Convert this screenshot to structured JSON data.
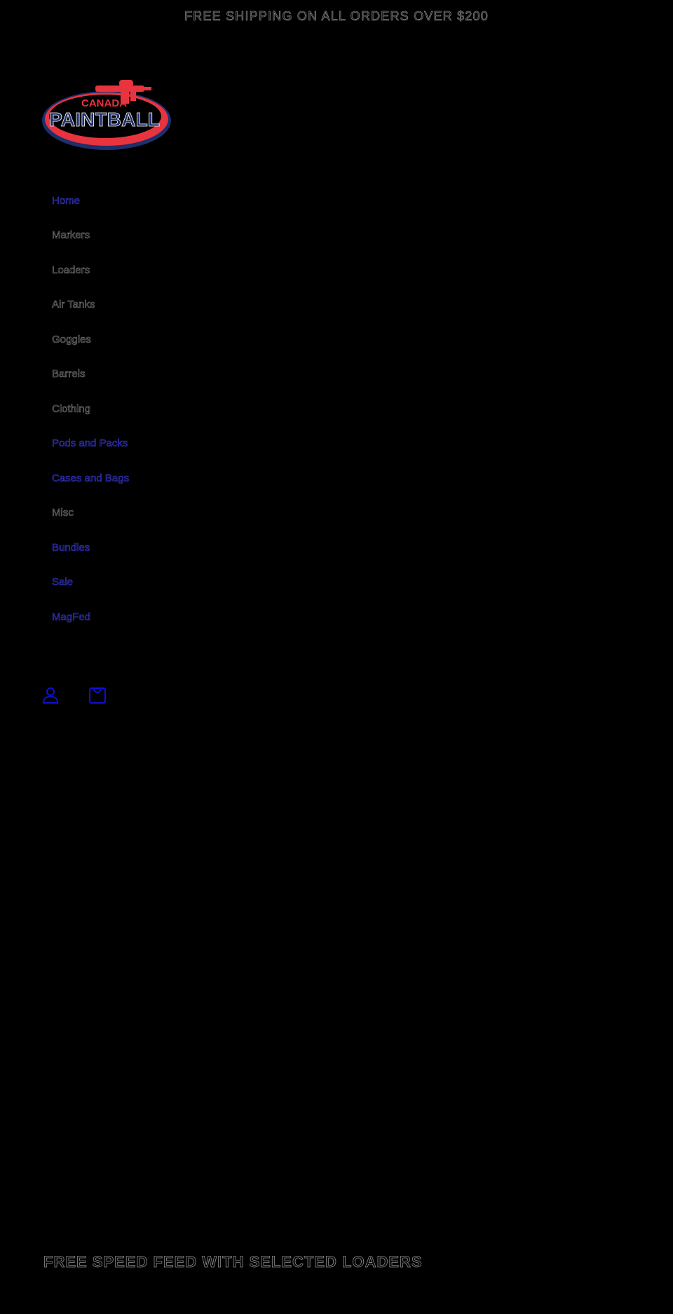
{
  "announcement": "FREE SHIPPING ON ALL ORDERS OVER $200",
  "logo": {
    "line1": "CANADA",
    "line2": "PAINTBALL"
  },
  "nav": [
    {
      "label": "Home",
      "active": true
    },
    {
      "label": "Markers",
      "active": false
    },
    {
      "label": "Loaders",
      "active": false
    },
    {
      "label": "Air Tanks",
      "active": false
    },
    {
      "label": "Goggles",
      "active": false
    },
    {
      "label": "Barrels",
      "active": false
    },
    {
      "label": "Clothing",
      "active": false
    },
    {
      "label": "Pods and Packs",
      "active": true
    },
    {
      "label": "Cases and Bags",
      "active": true
    },
    {
      "label": "Misc",
      "active": false
    },
    {
      "label": "Bundles",
      "active": true
    },
    {
      "label": "Sale",
      "active": true
    },
    {
      "label": "MagFed",
      "active": true
    }
  ],
  "header_icons": [
    "account-icon",
    "cart-icon"
  ],
  "promo_banner": "FREE SPEED FEED WITH SELECTED LOADERS",
  "colors": {
    "background": "#000000",
    "link_blue": "#3c3cd8",
    "logo_red": "#e8343e",
    "logo_navy": "#1e2f6b"
  }
}
